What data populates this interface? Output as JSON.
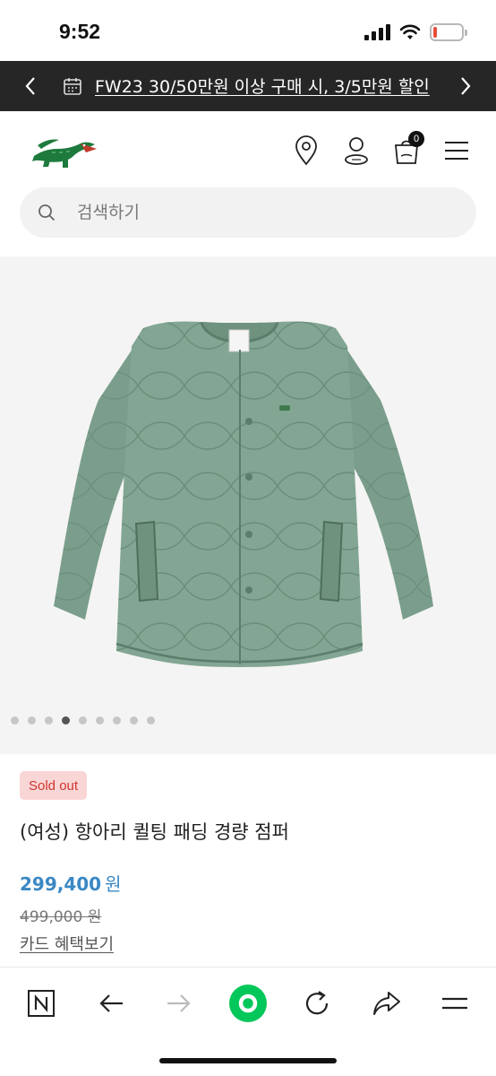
{
  "status_bar": {
    "time": "9:52",
    "battery_level": 0.12,
    "battery_color": "#e74c3c"
  },
  "promo": {
    "text": "FW23 30/50만원 이상 구매 시, 3/5만원 할인",
    "background": "#262626"
  },
  "header": {
    "cart_count": "0"
  },
  "search": {
    "placeholder": "검색하기"
  },
  "gallery": {
    "image_count": 9,
    "active_index": 3,
    "jacket_color": "#7a9e8b"
  },
  "product": {
    "badge": "Sold out",
    "name": "(여성) 항아리 퀼팅 패딩 경량 점퍼",
    "price": "299,400",
    "price_unit": "원",
    "original_price": "499,000 원",
    "card_benefits_link": "카드 혜택보기"
  },
  "browser_toolbar": {
    "icons": [
      "naver-n-icon",
      "back-arrow-icon",
      "forward-arrow-icon",
      "green-circle-icon",
      "reload-icon",
      "share-icon",
      "menu-icon"
    ],
    "accent": "#03c75a"
  }
}
